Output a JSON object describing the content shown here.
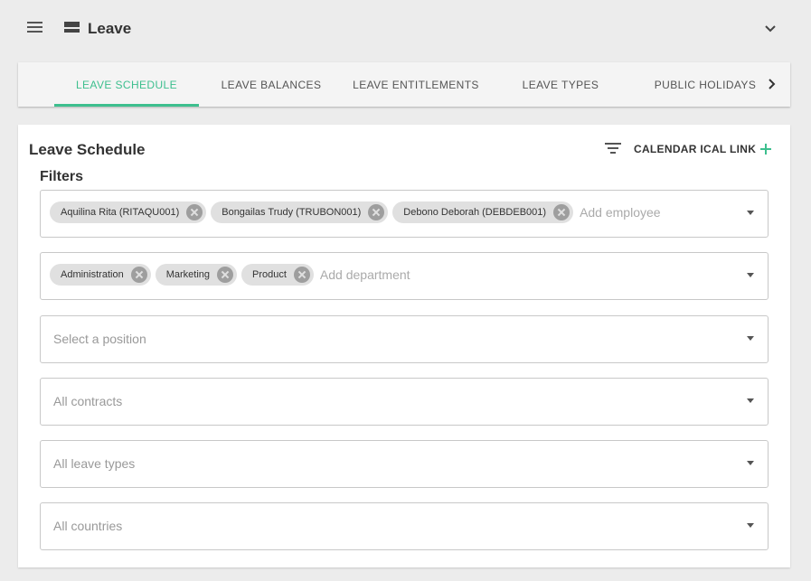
{
  "header": {
    "title": "Leave",
    "menu_icon": "hamburger-icon",
    "app_icon": "leave-icon",
    "chevron_icon": "chevron-down-icon"
  },
  "tabs": [
    {
      "label": "LEAVE SCHEDULE",
      "active": true
    },
    {
      "label": "LEAVE BALANCES",
      "active": false
    },
    {
      "label": "LEAVE ENTITLEMENTS",
      "active": false
    },
    {
      "label": "LEAVE TYPES",
      "active": false
    },
    {
      "label": "PUBLIC HOLIDAYS",
      "active": false
    }
  ],
  "colors": {
    "accent": "#3dbf8e"
  },
  "card": {
    "title": "Leave Schedule",
    "ical_label": "CALENDAR ICAL LINK",
    "filters_label": "Filters"
  },
  "filters": {
    "employees": {
      "chips": [
        "Aquilina Rita (RITAQU001)",
        "Bongailas Trudy (TRUBON001)",
        "Debono Deborah (DEBDEB001)"
      ],
      "placeholder": "Add employee"
    },
    "departments": {
      "chips": [
        "Administration",
        "Marketing",
        "Product"
      ],
      "placeholder": "Add department"
    },
    "position": {
      "placeholder": "Select a position"
    },
    "contracts": {
      "placeholder": "All contracts"
    },
    "leave_types": {
      "placeholder": "All leave types"
    },
    "countries": {
      "placeholder": "All countries"
    }
  }
}
